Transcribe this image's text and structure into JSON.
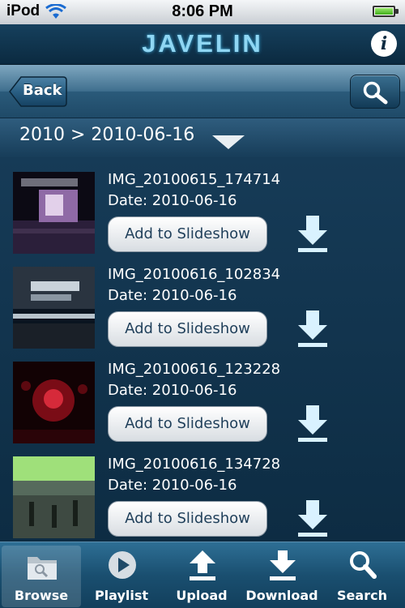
{
  "status_bar": {
    "carrier": "iPod",
    "time": "8:06 PM"
  },
  "header": {
    "title": "JAVELIN"
  },
  "nav": {
    "back_label": "Back"
  },
  "breadcrumb": {
    "path": "2010 > 2010-06-16"
  },
  "items": [
    {
      "name": "IMG_20100615_174714",
      "date": "Date: 2010-06-16",
      "action": "Add to Slideshow"
    },
    {
      "name": "IMG_20100616_102834",
      "date": "Date: 2010-06-16",
      "action": "Add to Slideshow"
    },
    {
      "name": "IMG_20100616_123228",
      "date": "Date: 2010-06-16",
      "action": "Add to Slideshow"
    },
    {
      "name": "IMG_20100616_134728",
      "date": "Date: 2010-06-16",
      "action": "Add to Slideshow"
    }
  ],
  "tabs": [
    {
      "label": "Browse",
      "icon": "folder-search-icon",
      "active": true
    },
    {
      "label": "Playlist",
      "icon": "play-icon"
    },
    {
      "label": "Upload",
      "icon": "upload-icon"
    },
    {
      "label": "Download",
      "icon": "download-icon"
    },
    {
      "label": "Search",
      "icon": "search-icon"
    }
  ],
  "colors": {
    "accent": "#8fd6f3",
    "background": "#0c2a40",
    "button_text": "#1f3f5a"
  }
}
